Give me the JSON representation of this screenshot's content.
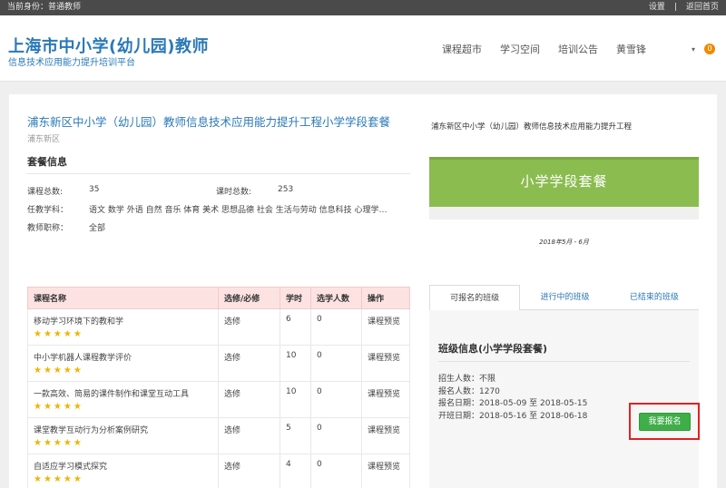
{
  "topbar": {
    "identity": "当前身份：普通教师",
    "settings": "设置",
    "separator": "|",
    "home": "返回首页"
  },
  "header": {
    "logo_main": "上海市中小学(幼儿园)教师",
    "logo_sub": "信息技术应用能力提升培训平台"
  },
  "nav": {
    "items": [
      "课程超市",
      "学习空间",
      "培训公告"
    ],
    "user": "黄雪锋",
    "caret": "▾",
    "badge": "0"
  },
  "package": {
    "title": "浦东新区中小学（幼儿园）教师信息技术应用能力提升工程小学学段套餐",
    "district": "浦东新区",
    "section_title": "套餐信息",
    "course_count_label": "课程总数:",
    "course_count": "35",
    "hours_label": "课时总数:",
    "hours": "253",
    "subjects_label": "任教学科：",
    "subjects": "语文 数学 外语 自然 音乐 体育 美术 思想品德 社会 生活与劳动 信息科技 心理学…",
    "titles_label": "教师职称：",
    "titles": "全部"
  },
  "table": {
    "headers": [
      "课程名称",
      "选修/必修",
      "学时",
      "选学人数",
      "操作"
    ],
    "rows": [
      {
        "name": "移动学习环境下的教和学",
        "type": "选修",
        "hours": "6",
        "learners": "0",
        "action": "课程预览",
        "stars": "★★★★★"
      },
      {
        "name": "中小学机器人课程教学评价",
        "type": "选修",
        "hours": "10",
        "learners": "0",
        "action": "课程预览",
        "stars": "★★★★★"
      },
      {
        "name": "一款高效、简易的课件制作和课堂互动工具",
        "type": "选修",
        "hours": "10",
        "learners": "0",
        "action": "课程预览",
        "stars": "★★★★★"
      },
      {
        "name": "课堂教学互动行为分析案例研究",
        "type": "选修",
        "hours": "5",
        "learners": "0",
        "action": "课程预览",
        "stars": "★★★★★"
      },
      {
        "name": "自适应学习模式探究",
        "type": "选修",
        "hours": "4",
        "learners": "0",
        "action": "课程预览",
        "stars": "★★★★★"
      }
    ]
  },
  "right": {
    "title": "浦东新区中小学（幼儿园）教师信息技术应用能力提升工程",
    "banner_text": "小学学段套餐",
    "banner_date": "2018年5月 - 6月",
    "tabs": [
      "可报名的班级",
      "进行中的班级",
      "已结束的班级"
    ],
    "class_title": "班级信息(小学学段套餐)",
    "enroll_limit": "招生人数：不限",
    "enrolled": "报名人数：1270",
    "signup_dates": "报名日期：2018-05-09 至 2018-05-15",
    "class_dates": "开班日期：2018-05-16 至 2018-06-18",
    "enroll_button": "我要报名"
  },
  "colors": {
    "accent": "#2a79b8",
    "banner": "#8bbc50",
    "enroll": "#3fae49",
    "highlight": "#e32020",
    "badge": "#f08a00"
  }
}
